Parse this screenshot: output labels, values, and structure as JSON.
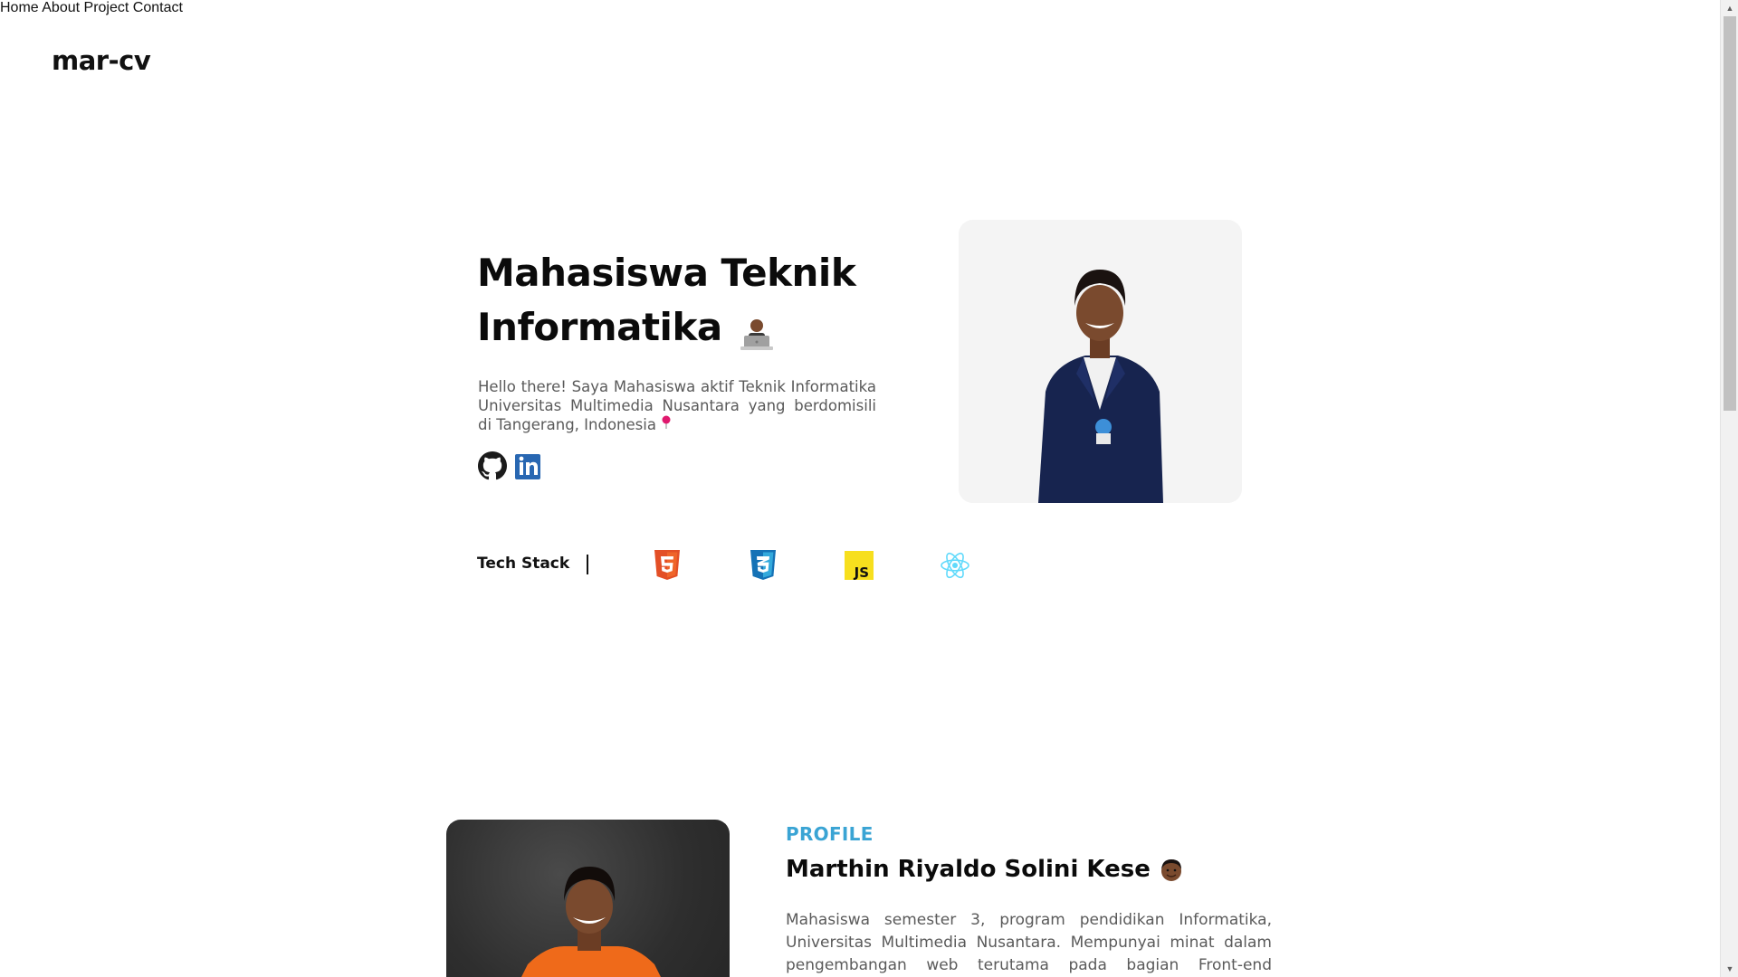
{
  "header": {
    "logo": "mar-cv",
    "nav": [
      {
        "label": "Home"
      },
      {
        "label": "About"
      },
      {
        "label": "Project"
      },
      {
        "label": "Contact"
      }
    ]
  },
  "hero": {
    "title_line1": "Mahasiswa Teknik",
    "title_line2": "Informatika",
    "title_emoji": "technologist-emoji",
    "description": "Hello there! Saya Mahasiswa aktif Teknik Informatika Universitas Multimedia Nusantara yang berdomisili di Tangerang, Indonesia",
    "description_icon": "pin-icon",
    "socials": [
      {
        "name": "github-icon"
      },
      {
        "name": "linkedin-icon"
      }
    ]
  },
  "tech_stack": {
    "label": "Tech Stack",
    "icons": [
      "html5-icon",
      "css3-icon",
      "javascript-icon",
      "react-icon"
    ],
    "colors": {
      "html5": "#e34f26",
      "css3": "#1572b6",
      "javascript": "#f7df1e",
      "react": "#61dafb"
    }
  },
  "profile": {
    "kicker": "PROFILE",
    "name": "Marthin Riyaldo Solini Kese",
    "name_emoji": "face-emoji",
    "description": "Mahasiswa semester 3, program pendidikan Informatika, Universitas Multimedia Nusantara. Mempunyai minat dalam pengembangan web terutama pada bagian Front-end"
  },
  "colors": {
    "accent": "#3aa4d4",
    "text": "#0b0b0b",
    "muted": "#5a5a5a"
  }
}
